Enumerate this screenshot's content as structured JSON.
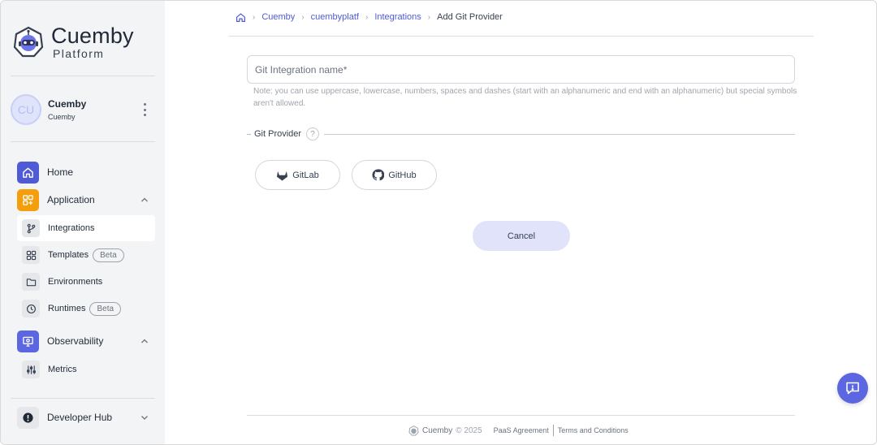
{
  "brand": {
    "title": "Cuemby",
    "subtitle": "Platform"
  },
  "user": {
    "initials": "CU",
    "name": "Cuemby",
    "org": "Cuemby"
  },
  "sidebar": {
    "home": {
      "label": "Home",
      "icon": "home-icon",
      "color": "#4f5bd5"
    },
    "application": {
      "label": "Application",
      "icon": "apps-icon",
      "color": "#f59e0b",
      "items": [
        {
          "label": "Integrations",
          "icon": "git-branch-icon",
          "active": true
        },
        {
          "label": "Templates",
          "icon": "grid-icon",
          "badge": "Beta"
        },
        {
          "label": "Environments",
          "icon": "folder-icon"
        },
        {
          "label": "Runtimes",
          "icon": "clock-icon",
          "badge": "Beta"
        }
      ]
    },
    "observability": {
      "label": "Observability",
      "icon": "monitor-icon",
      "color": "#5b66e0",
      "items": [
        {
          "label": "Metrics",
          "icon": "sliders-icon"
        }
      ]
    },
    "developer_hub": {
      "label": "Developer Hub",
      "icon": "alert-icon"
    }
  },
  "breadcrumb": {
    "items": [
      {
        "label": "Cuemby"
      },
      {
        "label": "cuembyplatf"
      },
      {
        "label": "Integrations"
      }
    ],
    "current": "Add Git Provider"
  },
  "form": {
    "name_placeholder": "Git Integration name*",
    "note": "Note: you can use uppercase, lowercase, numbers, spaces and dashes (start with an alphanumeric and end with an alphanumeric) but special symbols aren't allowed.",
    "provider_label": "Git Provider",
    "help": "?",
    "providers": [
      {
        "label": "GitLab",
        "icon": "gitlab-icon"
      },
      {
        "label": "GitHub",
        "icon": "github-icon"
      }
    ],
    "cancel_label": "Cancel"
  },
  "footer": {
    "brand": "Cuemby",
    "year": "© 2025",
    "paas": "PaaS Agreement",
    "terms": "Terms and Conditions"
  },
  "colors": {
    "accent": "#5b66e0",
    "link": "#4f5bd5",
    "sidebar_bg": "#f3f4f6"
  }
}
